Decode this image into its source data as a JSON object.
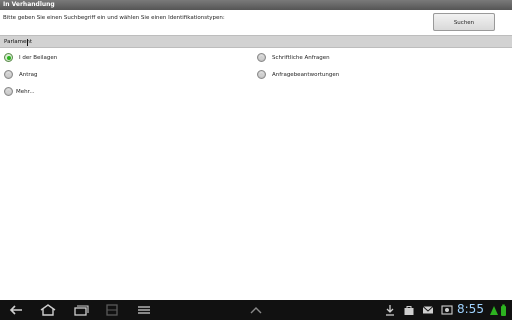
{
  "app": {
    "title": "In Verhandlung"
  },
  "search": {
    "prompt": "Bitte geben Sie einen Suchbegriff ein und wählen Sie einen Identifikationstypen:",
    "button": "Suchen",
    "value": "Parlament"
  },
  "options": {
    "o1": "I der Beilagen",
    "o2": "Schriftliche Anfragen",
    "o3": "Antrag",
    "o4": "Anfragebeantwortungen",
    "o5": "Mehr..."
  },
  "selected_option": "I der Beilagen",
  "status": {
    "time": "8:55"
  },
  "icons": {
    "back": "back-icon",
    "home": "home-icon",
    "recent": "recent-apps-icon",
    "screenshot": "screenshot-icon",
    "menu": "menu-icon",
    "up": "chevron-up-icon",
    "download": "download-icon",
    "bag": "shopping-bag-icon",
    "mail": "mail-icon",
    "photo": "photo-icon",
    "battery": "battery-icon"
  },
  "colors": {
    "accent_green": "#2db320",
    "titlebar": "#666666",
    "clock": "#9fd3ff"
  }
}
